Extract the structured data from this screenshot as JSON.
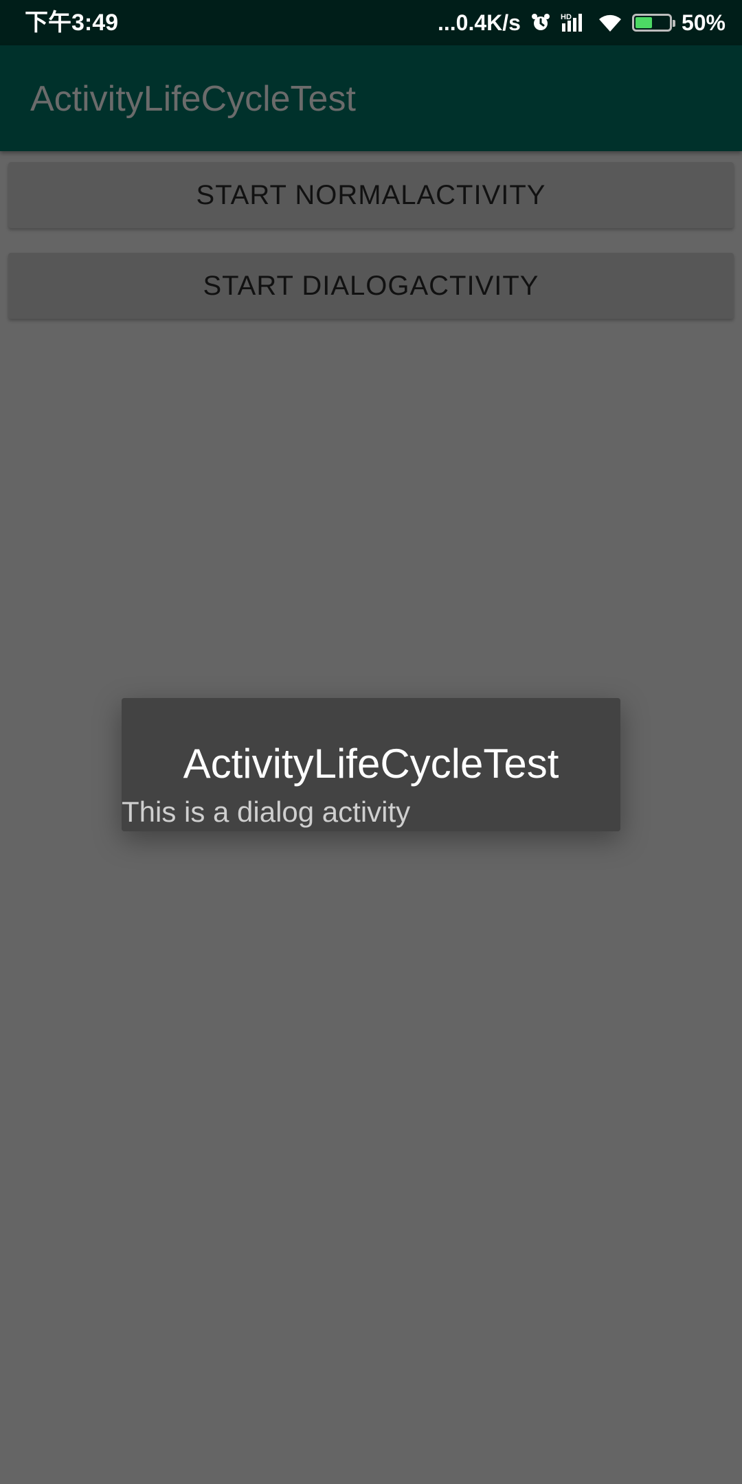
{
  "status_bar": {
    "time": "下午3:49",
    "network_speed": "...0.4K/s",
    "battery_percent": "50%",
    "battery_level": 0.5,
    "icons": [
      "alarm-icon",
      "signal-hd-icon",
      "wifi-icon",
      "battery-icon"
    ]
  },
  "app_bar": {
    "title": "ActivityLifeCycleTest"
  },
  "buttons": {
    "start_normal": "START NORMALACTIVITY",
    "start_dialog": "START DIALOGACTIVITY"
  },
  "dialog": {
    "title": "ActivityLifeCycleTest",
    "message": "This is a dialog activity"
  },
  "colors": {
    "status_bar": "#001e19",
    "app_bar": "#00312b",
    "scrim_background": "#656565",
    "dialog_background": "#434343",
    "battery_fill": "#4cd964"
  }
}
